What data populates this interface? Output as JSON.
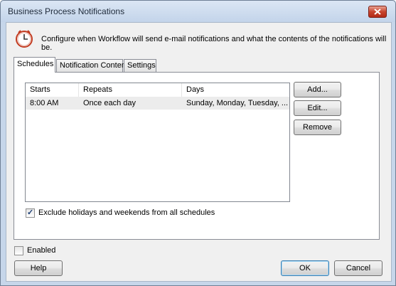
{
  "window": {
    "title": "Business Process Notifications"
  },
  "header": {
    "description": "Configure when Workflow will send e-mail notifications and what the contents of the notifications will be."
  },
  "tabs": [
    {
      "label": "Schedules",
      "active": true
    },
    {
      "label": "Notification Content",
      "active": false
    },
    {
      "label": "Settings",
      "active": false
    }
  ],
  "schedules": {
    "columns": [
      "Starts",
      "Repeats",
      "Days"
    ],
    "rows": [
      {
        "starts": "8:00 AM",
        "repeats": "Once each day",
        "days": "Sunday, Monday, Tuesday, ..."
      }
    ],
    "buttons": {
      "add": "Add...",
      "edit": "Edit...",
      "remove": "Remove"
    },
    "exclude_holidays": {
      "label": "Exclude holidays and weekends from all schedules",
      "checked": true
    }
  },
  "footer": {
    "enabled": {
      "label": "Enabled",
      "checked": false
    },
    "help": "Help",
    "ok": "OK",
    "cancel": "Cancel"
  },
  "colors": {
    "title_bar": "#c6d6ea",
    "close_button": "#c7442e",
    "selected_row": "#ececec",
    "default_button_border": "#3c7fb1"
  }
}
